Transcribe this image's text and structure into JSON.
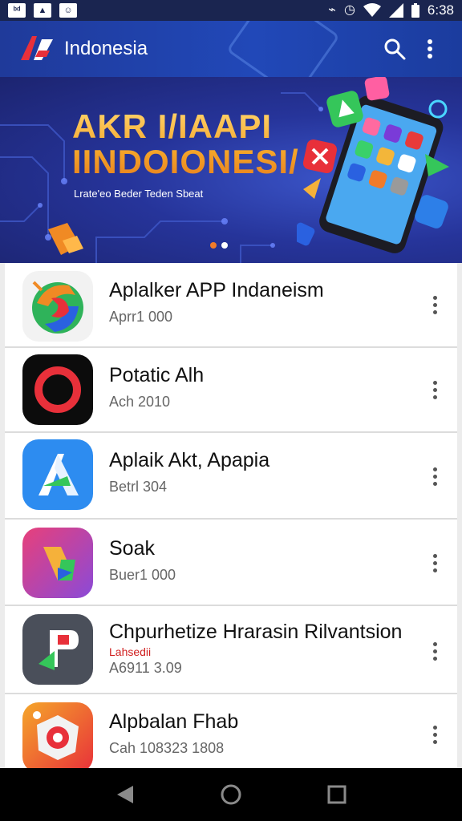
{
  "status_bar": {
    "time": "6:38",
    "left_icons": [
      "notification-icon",
      "image-icon",
      "chat-icon"
    ],
    "right_icons": [
      "vibrate-icon",
      "alarm-icon",
      "wifi-icon",
      "signal-icon",
      "battery-icon"
    ]
  },
  "app_bar": {
    "title": "Indonesia",
    "search_icon": "search-icon",
    "menu_icon": "more-vert-icon",
    "color": "#2148b8"
  },
  "banner": {
    "title": "AKR I/IAAPI\nIINDOIONESI/",
    "subtitle": "Lrate'eo Beder Teden Sbeat",
    "slides": 2,
    "active_slide": 1
  },
  "apps": [
    {
      "name": "Aplalker APP Indaneism",
      "tag": "",
      "meta": "Aprr1 000",
      "icon": "swirl-icon"
    },
    {
      "name": "Potatic Alh",
      "tag": "",
      "meta": "Ach 2010",
      "icon": "ring-icon"
    },
    {
      "name": "Aplaik Akt, Apapia",
      "tag": "",
      "meta": "Betrl 304",
      "icon": "triangle-a-icon"
    },
    {
      "name": "Soak",
      "tag": "",
      "meta": "Buer1 000",
      "icon": "fold-icon"
    },
    {
      "name": "Chpurhetize Hrarasin Rilvantsion",
      "tag": "Lahsedii",
      "meta": "A6911 3.09",
      "icon": "p-letter-icon"
    },
    {
      "name": "Alpbalan Fhab",
      "tag": "",
      "meta": "Cah 108323 1808",
      "icon": "camera-star-icon"
    }
  ],
  "nav": {
    "back": "back-icon",
    "home": "home-icon",
    "recents": "recents-icon"
  }
}
